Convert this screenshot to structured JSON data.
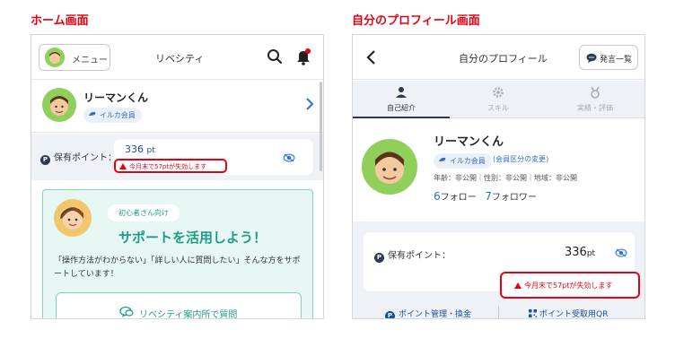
{
  "captions": {
    "home": "ホーム画面",
    "profile": "自分のプロフィール画面"
  },
  "home": {
    "menu_label": "メニュー",
    "app_title": "リベシティ",
    "user": {
      "name": "リーマンくん",
      "badge": "イルカ会員"
    },
    "points": {
      "label": "保有ポイント：",
      "value": "336",
      "unit": "pt",
      "warning": "今月末で57ptが失効します"
    },
    "support": {
      "pill": "初心者さん向け",
      "headline": "サポートを活用しよう！",
      "description": "「操作方法がわからない」「詳しい人に質問したい」そんな方をサポートしています！",
      "button_label": "リベシティ案内所で質問"
    }
  },
  "profile": {
    "title": "自分のプロフィール",
    "posts_button": "発言一覧",
    "tabs": [
      {
        "label": "自己紹介",
        "active": true
      },
      {
        "label": "スキル",
        "active": false
      },
      {
        "label": "実績・評価",
        "active": false
      }
    ],
    "user": {
      "name": "リーマンくん",
      "badge": "イルカ会員",
      "change_link": "(会員区分の変更)",
      "meta": "年齢：非公開｜性別：非公開｜地域：非公開",
      "followers_num": "6",
      "followers_label": "フォロー",
      "following_num": "7",
      "following_label": "フォロワー"
    },
    "points": {
      "label": "保有ポイント：",
      "value": "336",
      "unit": "pt",
      "warning": "今月末で57ptが失効します"
    },
    "links": {
      "manage": "ポイント管理・換金",
      "qr": "ポイント受取用QR"
    }
  },
  "colors": {
    "accent_red": "#e60012",
    "navy": "#2e3a4f",
    "teal": "#1f9c86",
    "link_blue": "#2b6fd1"
  }
}
